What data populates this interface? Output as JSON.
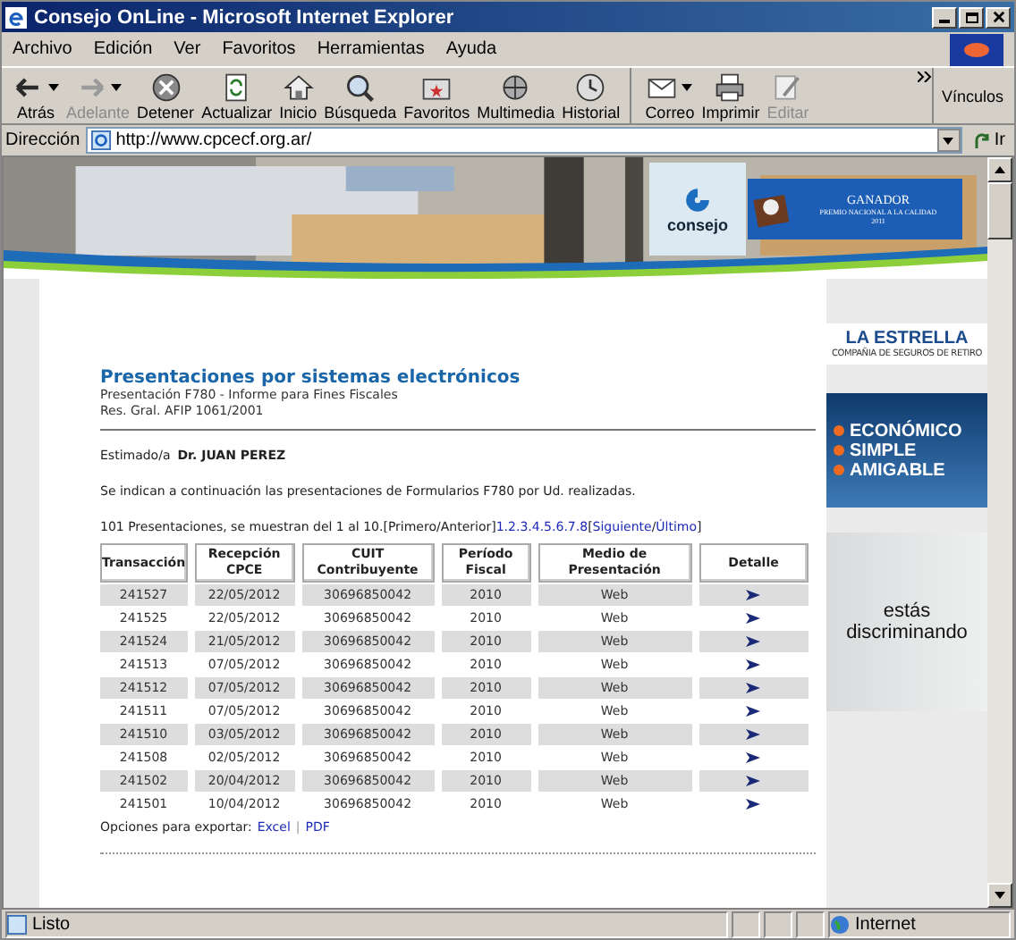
{
  "window": {
    "title": "Consejo OnLine - Microsoft Internet Explorer"
  },
  "menu": [
    "Archivo",
    "Edición",
    "Ver",
    "Favoritos",
    "Herramientas",
    "Ayuda"
  ],
  "toolbar": [
    {
      "kind": "back",
      "label": "Atrás",
      "disabled": false,
      "dropdown": true
    },
    {
      "kind": "forward",
      "label": "Adelante",
      "disabled": true,
      "dropdown": true
    },
    {
      "kind": "stop",
      "label": "Detener",
      "disabled": false,
      "dropdown": false
    },
    {
      "kind": "refresh",
      "label": "Actualizar",
      "disabled": false,
      "dropdown": false
    },
    {
      "kind": "home",
      "label": "Inicio",
      "disabled": false,
      "dropdown": false
    },
    {
      "kind": "search",
      "label": "Búsqueda",
      "disabled": false,
      "dropdown": false
    },
    {
      "kind": "favorites",
      "label": "Favoritos",
      "disabled": false,
      "dropdown": false
    },
    {
      "kind": "media",
      "label": "Multimedia",
      "disabled": false,
      "dropdown": false
    },
    {
      "kind": "history",
      "label": "Historial",
      "disabled": false,
      "dropdown": false
    },
    {
      "kind": "mail",
      "label": "Correo",
      "disabled": false,
      "dropdown": true
    },
    {
      "kind": "print",
      "label": "Imprimir",
      "disabled": false,
      "dropdown": false
    },
    {
      "kind": "edit",
      "label": "Editar",
      "disabled": true,
      "dropdown": false
    }
  ],
  "links_label": "Vínculos",
  "address": {
    "label": "Dirección",
    "value": "http://www.cpcecf.org.ar/",
    "go": "Ir"
  },
  "banner": {
    "logo": "consejo",
    "award_title": "GANADOR",
    "award_text": "PREMIO NACIONAL A LA CALIDAD",
    "award_year": "2011"
  },
  "page": {
    "title": "Presentaciones por sistemas electrónicos",
    "subtitle": "Presentación F780 - Informe para Fines Fiscales",
    "resolution": "Res. Gral. AFIP 1061/2001",
    "greeting": "Estimado/a",
    "name": "Dr. JUAN PEREZ",
    "intro": "Se indican a continuación las presentaciones de Formularios F780 por Ud. realizadas.",
    "pagination": [
      {
        "kind": "text",
        "text": "101 Presentaciones, se muestran del 1 al 10.[Primero/Anterior]"
      },
      {
        "kind": "link",
        "text": "1.2.3.4.5.6.7.8"
      },
      {
        "kind": "text",
        "text": "["
      },
      {
        "kind": "link",
        "text": "Siguiente"
      },
      {
        "kind": "text",
        "text": "/"
      },
      {
        "kind": "link",
        "text": "Último"
      },
      {
        "kind": "text",
        "text": "]"
      }
    ],
    "table": {
      "columns": [
        "Transacción",
        "Recepción CPCE",
        "CUIT Contribuyente",
        "Período Fiscal",
        "Medio de Presentación",
        "Detalle"
      ],
      "rows": [
        [
          "241527",
          "22/05/2012",
          "30696850042",
          "2010",
          "Web"
        ],
        [
          "241525",
          "22/05/2012",
          "30696850042",
          "2010",
          "Web"
        ],
        [
          "241524",
          "21/05/2012",
          "30696850042",
          "2010",
          "Web"
        ],
        [
          "241513",
          "07/05/2012",
          "30696850042",
          "2010",
          "Web"
        ],
        [
          "241512",
          "07/05/2012",
          "30696850042",
          "2010",
          "Web"
        ],
        [
          "241511",
          "07/05/2012",
          "30696850042",
          "2010",
          "Web"
        ],
        [
          "241510",
          "03/05/2012",
          "30696850042",
          "2010",
          "Web"
        ],
        [
          "241508",
          "02/05/2012",
          "30696850042",
          "2010",
          "Web"
        ],
        [
          "241502",
          "20/04/2012",
          "30696850042",
          "2010",
          "Web"
        ],
        [
          "241501",
          "10/04/2012",
          "30696850042",
          "2010",
          "Web"
        ]
      ]
    },
    "export": {
      "label": "Opciones para exportar:",
      "links": [
        "Excel",
        "PDF"
      ],
      "separator": "|"
    }
  },
  "ads": {
    "estrella": {
      "name": "LA ESTRELLA",
      "tagline": "COMPAÑIA DE SEGUROS DE RETIRO"
    },
    "bullets": [
      "ECONÓMICO",
      "SIMPLE",
      "AMIGABLE"
    ],
    "slogan": [
      "estás",
      "discriminando"
    ]
  },
  "status_bar": {
    "text": "Listo",
    "zone": "Internet"
  }
}
